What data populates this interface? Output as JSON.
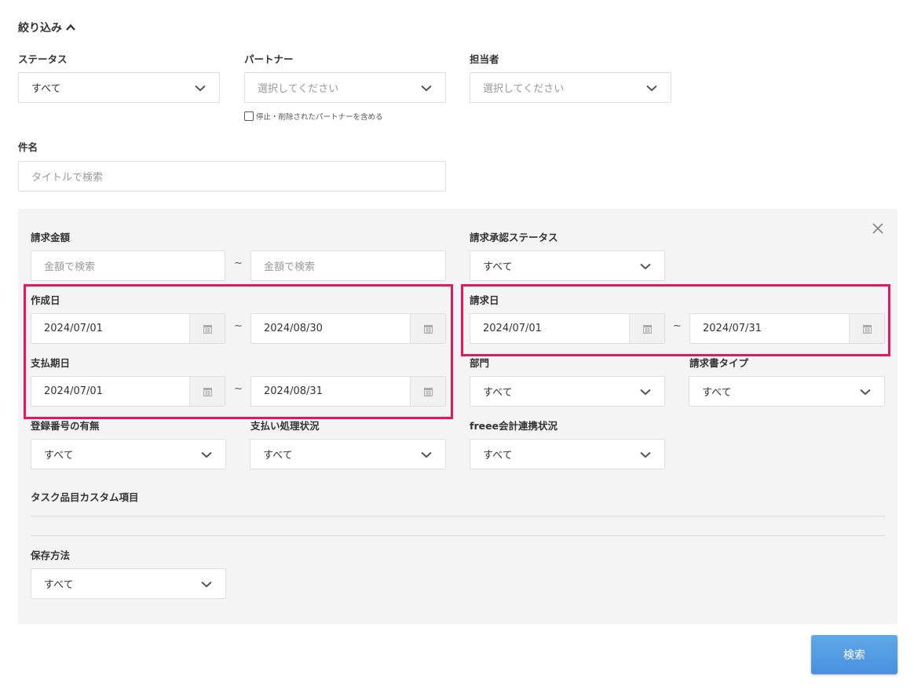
{
  "filter": {
    "title": "絞り込み",
    "status": {
      "label": "ステータス",
      "value": "すべて"
    },
    "partner": {
      "label": "パートナー",
      "placeholder": "選択してください",
      "include_deleted_label": "停止・削除されたパートナーを含める"
    },
    "assignee": {
      "label": "担当者",
      "placeholder": "選択してください"
    },
    "subject": {
      "label": "件名",
      "placeholder": "タイトルで検索"
    }
  },
  "advanced": {
    "amount": {
      "label": "請求金額",
      "from_placeholder": "金額で検索",
      "to_placeholder": "金額で検索"
    },
    "approval_status": {
      "label": "請求承認ステータス",
      "value": "すべて"
    },
    "created_date": {
      "label": "作成日",
      "from": "2024/07/01",
      "to": "2024/08/30"
    },
    "invoice_date": {
      "label": "請求日",
      "from": "2024/07/01",
      "to": "2024/07/31"
    },
    "payment_due": {
      "label": "支払期日",
      "from": "2024/07/01",
      "to": "2024/08/31"
    },
    "department": {
      "label": "部門",
      "value": "すべて"
    },
    "invoice_type": {
      "label": "請求書タイプ",
      "value": "すべて"
    },
    "registration_number": {
      "label": "登録番号の有無",
      "value": "すべて"
    },
    "payment_status": {
      "label": "支払い処理状況",
      "value": "すべて"
    },
    "freee_status": {
      "label": "freee会計連携状況",
      "value": "すべて"
    },
    "custom_items": {
      "label": "タスク品目カスタム項目"
    },
    "storage": {
      "label": "保存方法",
      "value": "すべて"
    },
    "separator": "~"
  },
  "search_button": "検索",
  "colors": {
    "highlight": "#e8155f",
    "button": "#4a90df",
    "panel": "#f4f4f4"
  }
}
